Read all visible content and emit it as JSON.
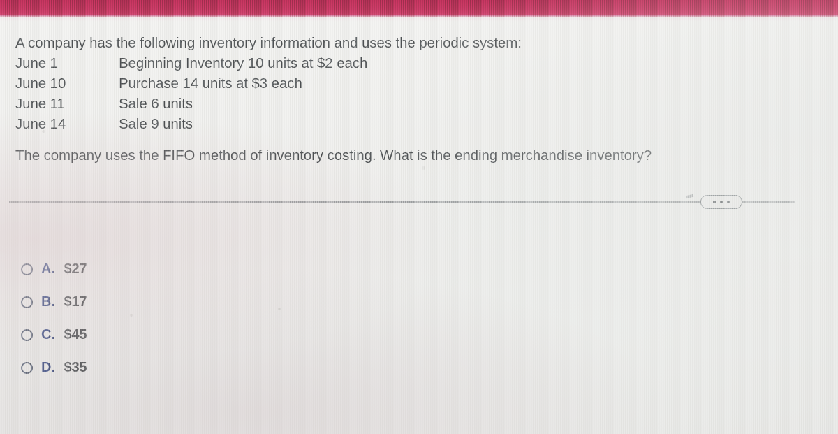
{
  "banner": {
    "color": "#9c1b3d",
    "label": ""
  },
  "problem": {
    "intro": "A company has the following inventory information and uses the periodic system:",
    "ledger": [
      {
        "date": "June 1",
        "description": "Beginning Inventory 10 units at $2 each"
      },
      {
        "date": "June 10",
        "description": "Purchase  14 units at $3 each"
      },
      {
        "date": "June 11",
        "description": "Sale  6 units"
      },
      {
        "date": "June 14",
        "description": "Sale 9 units"
      }
    ],
    "question": "The company uses the FIFO method of inventory costing. What is the ending merchandise inventory?"
  },
  "toolbar": {
    "more_label": "...",
    "more_icon": "ellipsis-icon"
  },
  "options": [
    {
      "letter": "A.",
      "value": "$27",
      "selected": false
    },
    {
      "letter": "B.",
      "value": "$17",
      "selected": false
    },
    {
      "letter": "C.",
      "value": "$45",
      "selected": false
    },
    {
      "letter": "D.",
      "value": "$35",
      "selected": false
    }
  ],
  "colors": {
    "banner": "#9c1b3d",
    "background": "#e9e9e6",
    "text": "#3a3d3f",
    "option_letter": "#2d3a63",
    "divider": "#82868 8"
  }
}
